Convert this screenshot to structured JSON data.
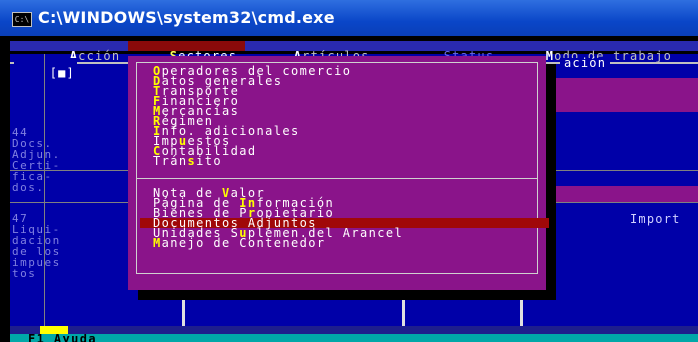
{
  "window": {
    "title": "C:\\WINDOWS\\system32\\cmd.exe",
    "icon_text": "C:\\"
  },
  "menubar": {
    "items": [
      {
        "hotkey": "A",
        "rest": "cción",
        "active": false
      },
      {
        "hotkey": "S",
        "rest": "ectores",
        "active": true
      },
      {
        "hotkey": "A",
        "rest": "rtículos",
        "active": false
      },
      {
        "hotkey": "",
        "rest": "Status",
        "active": false
      },
      {
        "hotkey": "M",
        "rest": "odo de trabajo",
        "active": false
      }
    ]
  },
  "window_bar": {
    "marker": "[■]",
    "partial_title": "ación"
  },
  "left_panel": {
    "block1": [
      "44",
      "Docs.",
      "Adjun.",
      "Certi-",
      "fica-",
      "dos."
    ],
    "block2": [
      "47",
      "Liqui-",
      "dacion",
      "de los",
      "impues",
      "tos"
    ]
  },
  "right_labels": {
    "import": "Import"
  },
  "dropdown": {
    "group1": [
      {
        "pre": "",
        "hk": "O",
        "post": "peradores del comercio"
      },
      {
        "pre": "",
        "hk": "D",
        "post": "atos generales"
      },
      {
        "pre": "",
        "hk": "T",
        "post": "ransporte"
      },
      {
        "pre": "",
        "hk": "F",
        "post": "inanciero"
      },
      {
        "pre": "",
        "hk": "M",
        "post": "ercancías"
      },
      {
        "pre": "",
        "hk": "R",
        "post": "égimen"
      },
      {
        "pre": "",
        "hk": "I",
        "post": "nfo. adicionales"
      },
      {
        "pre": "Imp",
        "hk": "u",
        "post": "estos"
      },
      {
        "pre": "",
        "hk": "C",
        "post": "ontabilidad"
      },
      {
        "pre": "Trán",
        "hk": "s",
        "post": "ito"
      }
    ],
    "group2": [
      {
        "pre": "Nota de ",
        "hk": "V",
        "post": "alor"
      },
      {
        "pre": "Página de ",
        "hk": "In",
        "post": "formación"
      },
      {
        "pre": "Bienes de P",
        "hk": "r",
        "post": "opietario"
      },
      {
        "pre": "Documentos Adjuntos",
        "hk": "",
        "post": ""
      },
      {
        "pre": "Unidades S",
        "hk": "u",
        "post": "plemen.del Arancel"
      },
      {
        "pre": "",
        "hk": "M",
        "post": "anejo de Contenedor"
      }
    ],
    "selected": "Documentos Adjuntos"
  },
  "statusbar": {
    "text": "F1 Ayuda"
  },
  "colors": {
    "background": "#0000a8",
    "menu_bg": "#8a148a",
    "selection": "#a00808",
    "hotkey": "#ffff00",
    "statusbar": "#00a8a8"
  }
}
